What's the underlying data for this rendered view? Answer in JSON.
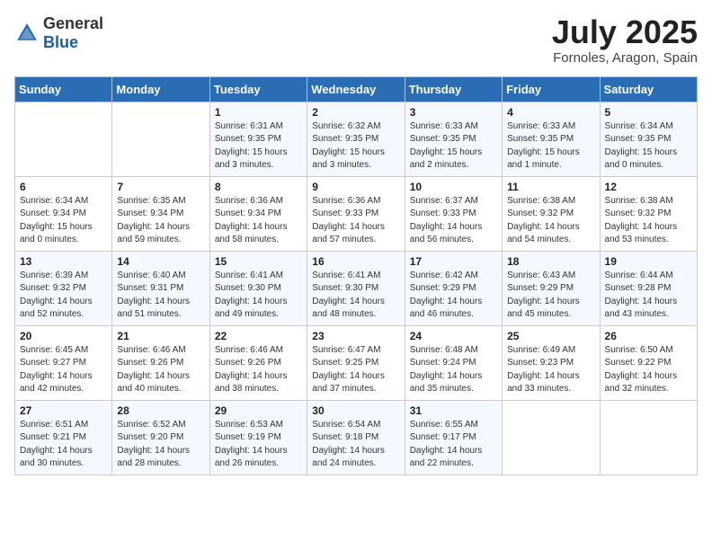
{
  "header": {
    "logo_general": "General",
    "logo_blue": "Blue",
    "month_year": "July 2025",
    "location": "Fornoles, Aragon, Spain"
  },
  "weekdays": [
    "Sunday",
    "Monday",
    "Tuesday",
    "Wednesday",
    "Thursday",
    "Friday",
    "Saturday"
  ],
  "weeks": [
    [
      {
        "day": "",
        "sunrise": "",
        "sunset": "",
        "daylight": ""
      },
      {
        "day": "",
        "sunrise": "",
        "sunset": "",
        "daylight": ""
      },
      {
        "day": "1",
        "sunrise": "Sunrise: 6:31 AM",
        "sunset": "Sunset: 9:35 PM",
        "daylight": "Daylight: 15 hours and 3 minutes."
      },
      {
        "day": "2",
        "sunrise": "Sunrise: 6:32 AM",
        "sunset": "Sunset: 9:35 PM",
        "daylight": "Daylight: 15 hours and 3 minutes."
      },
      {
        "day": "3",
        "sunrise": "Sunrise: 6:33 AM",
        "sunset": "Sunset: 9:35 PM",
        "daylight": "Daylight: 15 hours and 2 minutes."
      },
      {
        "day": "4",
        "sunrise": "Sunrise: 6:33 AM",
        "sunset": "Sunset: 9:35 PM",
        "daylight": "Daylight: 15 hours and 1 minute."
      },
      {
        "day": "5",
        "sunrise": "Sunrise: 6:34 AM",
        "sunset": "Sunset: 9:35 PM",
        "daylight": "Daylight: 15 hours and 0 minutes."
      }
    ],
    [
      {
        "day": "6",
        "sunrise": "Sunrise: 6:34 AM",
        "sunset": "Sunset: 9:34 PM",
        "daylight": "Daylight: 15 hours and 0 minutes."
      },
      {
        "day": "7",
        "sunrise": "Sunrise: 6:35 AM",
        "sunset": "Sunset: 9:34 PM",
        "daylight": "Daylight: 14 hours and 59 minutes."
      },
      {
        "day": "8",
        "sunrise": "Sunrise: 6:36 AM",
        "sunset": "Sunset: 9:34 PM",
        "daylight": "Daylight: 14 hours and 58 minutes."
      },
      {
        "day": "9",
        "sunrise": "Sunrise: 6:36 AM",
        "sunset": "Sunset: 9:33 PM",
        "daylight": "Daylight: 14 hours and 57 minutes."
      },
      {
        "day": "10",
        "sunrise": "Sunrise: 6:37 AM",
        "sunset": "Sunset: 9:33 PM",
        "daylight": "Daylight: 14 hours and 56 minutes."
      },
      {
        "day": "11",
        "sunrise": "Sunrise: 6:38 AM",
        "sunset": "Sunset: 9:32 PM",
        "daylight": "Daylight: 14 hours and 54 minutes."
      },
      {
        "day": "12",
        "sunrise": "Sunrise: 6:38 AM",
        "sunset": "Sunset: 9:32 PM",
        "daylight": "Daylight: 14 hours and 53 minutes."
      }
    ],
    [
      {
        "day": "13",
        "sunrise": "Sunrise: 6:39 AM",
        "sunset": "Sunset: 9:32 PM",
        "daylight": "Daylight: 14 hours and 52 minutes."
      },
      {
        "day": "14",
        "sunrise": "Sunrise: 6:40 AM",
        "sunset": "Sunset: 9:31 PM",
        "daylight": "Daylight: 14 hours and 51 minutes."
      },
      {
        "day": "15",
        "sunrise": "Sunrise: 6:41 AM",
        "sunset": "Sunset: 9:30 PM",
        "daylight": "Daylight: 14 hours and 49 minutes."
      },
      {
        "day": "16",
        "sunrise": "Sunrise: 6:41 AM",
        "sunset": "Sunset: 9:30 PM",
        "daylight": "Daylight: 14 hours and 48 minutes."
      },
      {
        "day": "17",
        "sunrise": "Sunrise: 6:42 AM",
        "sunset": "Sunset: 9:29 PM",
        "daylight": "Daylight: 14 hours and 46 minutes."
      },
      {
        "day": "18",
        "sunrise": "Sunrise: 6:43 AM",
        "sunset": "Sunset: 9:29 PM",
        "daylight": "Daylight: 14 hours and 45 minutes."
      },
      {
        "day": "19",
        "sunrise": "Sunrise: 6:44 AM",
        "sunset": "Sunset: 9:28 PM",
        "daylight": "Daylight: 14 hours and 43 minutes."
      }
    ],
    [
      {
        "day": "20",
        "sunrise": "Sunrise: 6:45 AM",
        "sunset": "Sunset: 9:27 PM",
        "daylight": "Daylight: 14 hours and 42 minutes."
      },
      {
        "day": "21",
        "sunrise": "Sunrise: 6:46 AM",
        "sunset": "Sunset: 9:26 PM",
        "daylight": "Daylight: 14 hours and 40 minutes."
      },
      {
        "day": "22",
        "sunrise": "Sunrise: 6:46 AM",
        "sunset": "Sunset: 9:26 PM",
        "daylight": "Daylight: 14 hours and 38 minutes."
      },
      {
        "day": "23",
        "sunrise": "Sunrise: 6:47 AM",
        "sunset": "Sunset: 9:25 PM",
        "daylight": "Daylight: 14 hours and 37 minutes."
      },
      {
        "day": "24",
        "sunrise": "Sunrise: 6:48 AM",
        "sunset": "Sunset: 9:24 PM",
        "daylight": "Daylight: 14 hours and 35 minutes."
      },
      {
        "day": "25",
        "sunrise": "Sunrise: 6:49 AM",
        "sunset": "Sunset: 9:23 PM",
        "daylight": "Daylight: 14 hours and 33 minutes."
      },
      {
        "day": "26",
        "sunrise": "Sunrise: 6:50 AM",
        "sunset": "Sunset: 9:22 PM",
        "daylight": "Daylight: 14 hours and 32 minutes."
      }
    ],
    [
      {
        "day": "27",
        "sunrise": "Sunrise: 6:51 AM",
        "sunset": "Sunset: 9:21 PM",
        "daylight": "Daylight: 14 hours and 30 minutes."
      },
      {
        "day": "28",
        "sunrise": "Sunrise: 6:52 AM",
        "sunset": "Sunset: 9:20 PM",
        "daylight": "Daylight: 14 hours and 28 minutes."
      },
      {
        "day": "29",
        "sunrise": "Sunrise: 6:53 AM",
        "sunset": "Sunset: 9:19 PM",
        "daylight": "Daylight: 14 hours and 26 minutes."
      },
      {
        "day": "30",
        "sunrise": "Sunrise: 6:54 AM",
        "sunset": "Sunset: 9:18 PM",
        "daylight": "Daylight: 14 hours and 24 minutes."
      },
      {
        "day": "31",
        "sunrise": "Sunrise: 6:55 AM",
        "sunset": "Sunset: 9:17 PM",
        "daylight": "Daylight: 14 hours and 22 minutes."
      },
      {
        "day": "",
        "sunrise": "",
        "sunset": "",
        "daylight": ""
      },
      {
        "day": "",
        "sunrise": "",
        "sunset": "",
        "daylight": ""
      }
    ]
  ]
}
